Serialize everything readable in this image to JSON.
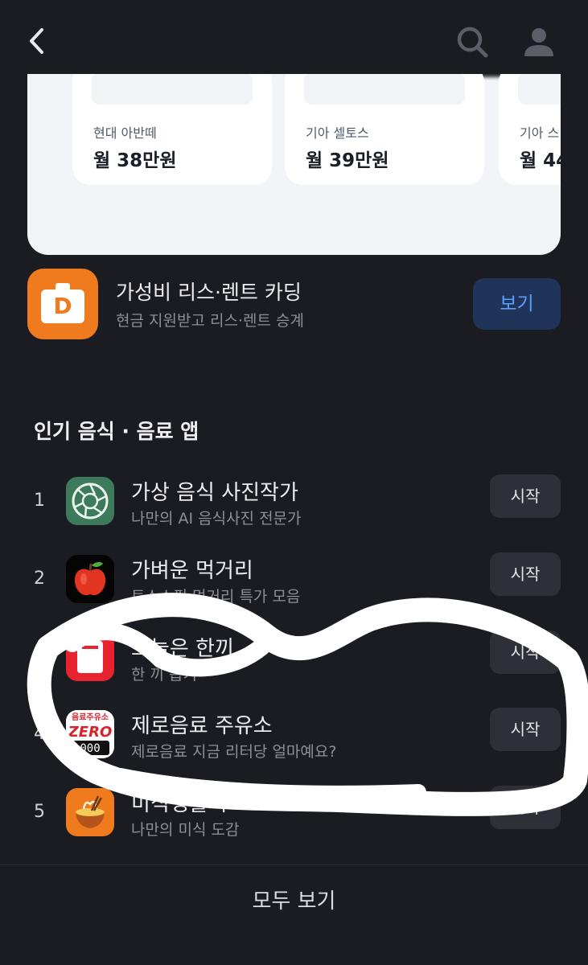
{
  "header": {
    "back_icon": "chevron-left-icon",
    "search_icon": "search-icon",
    "profile_icon": "user-icon"
  },
  "banner": {
    "cards": [
      {
        "name": "현대 아반떼",
        "price": "월 38만원"
      },
      {
        "name": "기아 셀토스",
        "price": "월 39만원"
      },
      {
        "name": "기아 스",
        "price": "월 44"
      }
    ]
  },
  "promo": {
    "icon_letter": "D",
    "title": "가성비 리스·렌트 카딩",
    "subtitle": "현금 지원받고 리스·렌트 승계",
    "button": "보기"
  },
  "section": {
    "title": "인기 음식 · 음료 앱",
    "apps": [
      {
        "rank": "1",
        "name": "가상 음식 사진작가",
        "subtitle": "나만의 AI 음식사진 전문가",
        "button": "시작"
      },
      {
        "rank": "2",
        "name": "가벼운 먹거리",
        "subtitle": "토스쇼핑 먹거리 특가 모음",
        "button": "시작"
      },
      {
        "rank": "3",
        "name": "오늘은 한끼",
        "subtitle": "한 끼 뽑기",
        "button": "시작"
      },
      {
        "rank": "4",
        "name": "제로음료 주유소",
        "subtitle": "제로음료 지금 리터당 얼마예요?",
        "button": "시작",
        "icon_top_text": "음료주유소",
        "icon_logo": "ZERO",
        "icon_counter": "000"
      },
      {
        "rank": "5",
        "name": "미식생활지",
        "subtitle": "나만의 미식 도감",
        "button": "시작"
      }
    ]
  },
  "footer": {
    "all_button": "모두 보기"
  },
  "colors": {
    "background": "#1b1b22",
    "accent_blue": "#5aa0ff",
    "promo_orange": "#f07a1e"
  }
}
